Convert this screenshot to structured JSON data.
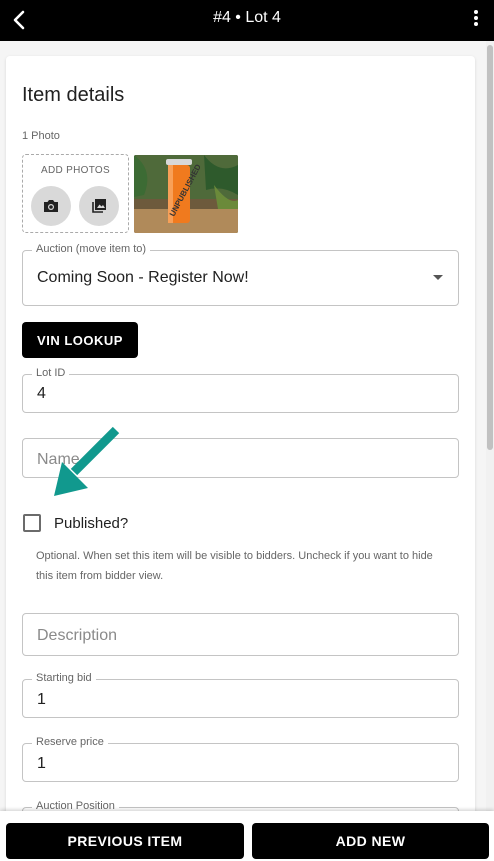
{
  "header": {
    "title": "#4 • Lot 4"
  },
  "item_details": {
    "heading": "Item details",
    "photo_count": "1 Photo",
    "add_photos_label": "ADD PHOTOS",
    "photo_watermark": "UNPUBLISHED",
    "auction": {
      "label": "Auction (move item to)",
      "value": "Coming Soon - Register Now!"
    },
    "vin_button": "VIN LOOKUP",
    "lot_id": {
      "label": "Lot ID",
      "value": "4"
    },
    "name": {
      "placeholder": "Name"
    },
    "published": {
      "label": "Published?",
      "checked": false,
      "help": "Optional. When set this item will be visible to bidders. Uncheck if you want to hide this item from bidder view."
    },
    "description": {
      "placeholder": "Description"
    },
    "starting_bid": {
      "label": "Starting bid",
      "value": "1"
    },
    "reserve_price": {
      "label": "Reserve price",
      "value": "1"
    },
    "auction_position": {
      "label": "Auction Position"
    }
  },
  "footer": {
    "previous_label": "PREVIOUS ITEM",
    "add_new_label": "ADD NEW"
  },
  "colors": {
    "annotation_arrow": "#11998e",
    "bar_background": "#000000"
  }
}
